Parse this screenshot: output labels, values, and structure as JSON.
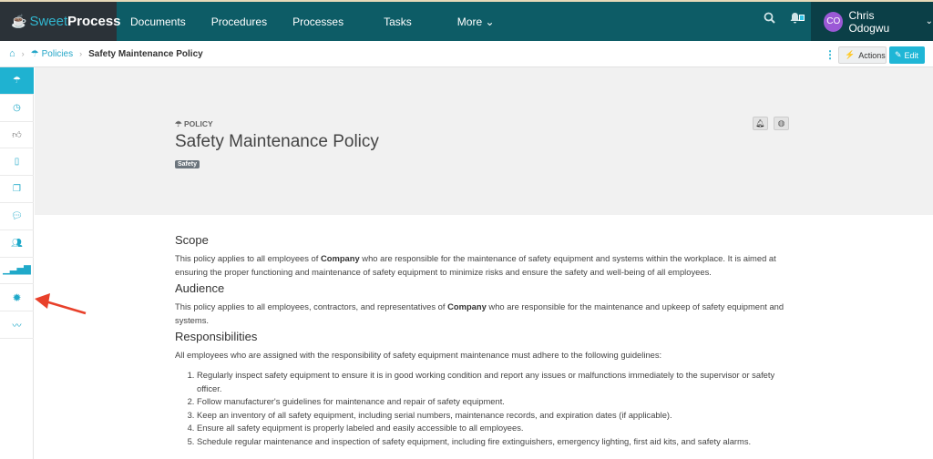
{
  "topbar": {
    "logo_sweet": "Sweet",
    "logo_process": "Process",
    "nav": [
      "Documents",
      "Procedures",
      "Processes",
      "Tasks",
      "More ⌄"
    ],
    "notification_count": "0",
    "user_initials": "CO",
    "user_name": "Chris Odogwu",
    "user_chevron": "⌄"
  },
  "breadcrumb": {
    "home_icon": "home-icon",
    "items": [
      "Policies",
      "Safety Maintenance Policy"
    ],
    "separator": "›"
  },
  "actions": {
    "more_icon": "⋮",
    "actions_label": "Actions",
    "edit_label": "Edit"
  },
  "sidebar": {
    "items": [
      "policy-umbrella-icon",
      "clock-icon",
      "thumbs-up-icon",
      "document-icon",
      "copy-icon",
      "comments-icon",
      "users-icon",
      "signal-icon",
      "gear-icon",
      "signature-icon"
    ]
  },
  "hero": {
    "kind": "POLICY",
    "title": "Safety Maintenance Policy",
    "tag": "Safety"
  },
  "sections": {
    "scope_title": "Scope",
    "scope_pre": "This policy applies to all employees of ",
    "scope_bold": "Company",
    "scope_post": " who are responsible for the maintenance of safety equipment and systems within the workplace. It is aimed at ensuring the proper functioning and maintenance of safety equipment to minimize risks and ensure the safety and well-being of all employees.",
    "audience_title": "Audience",
    "audience_pre": "This policy applies to all employees, contractors, and representatives of ",
    "audience_bold": "Company",
    "audience_post": " who are responsible for the maintenance and upkeep of safety equipment and systems.",
    "resp_title": "Responsibilities",
    "resp_intro": "All employees who are assigned with the responsibility of safety equipment maintenance must adhere to the following guidelines:",
    "resp_items": [
      "Regularly inspect safety equipment to ensure it is in good working condition and report any issues or malfunctions immediately to the supervisor or safety officer.",
      "Follow manufacturer's guidelines for maintenance and repair of safety equipment.",
      "Keep an inventory of all safety equipment, including serial numbers, maintenance records, and expiration dates (if applicable).",
      "Ensure all safety equipment is properly labeled and easily accessible to all employees.",
      "Schedule regular maintenance and inspection of safety equipment, including fire extinguishers, emergency lighting, first aid kits, and safety alarms."
    ]
  }
}
